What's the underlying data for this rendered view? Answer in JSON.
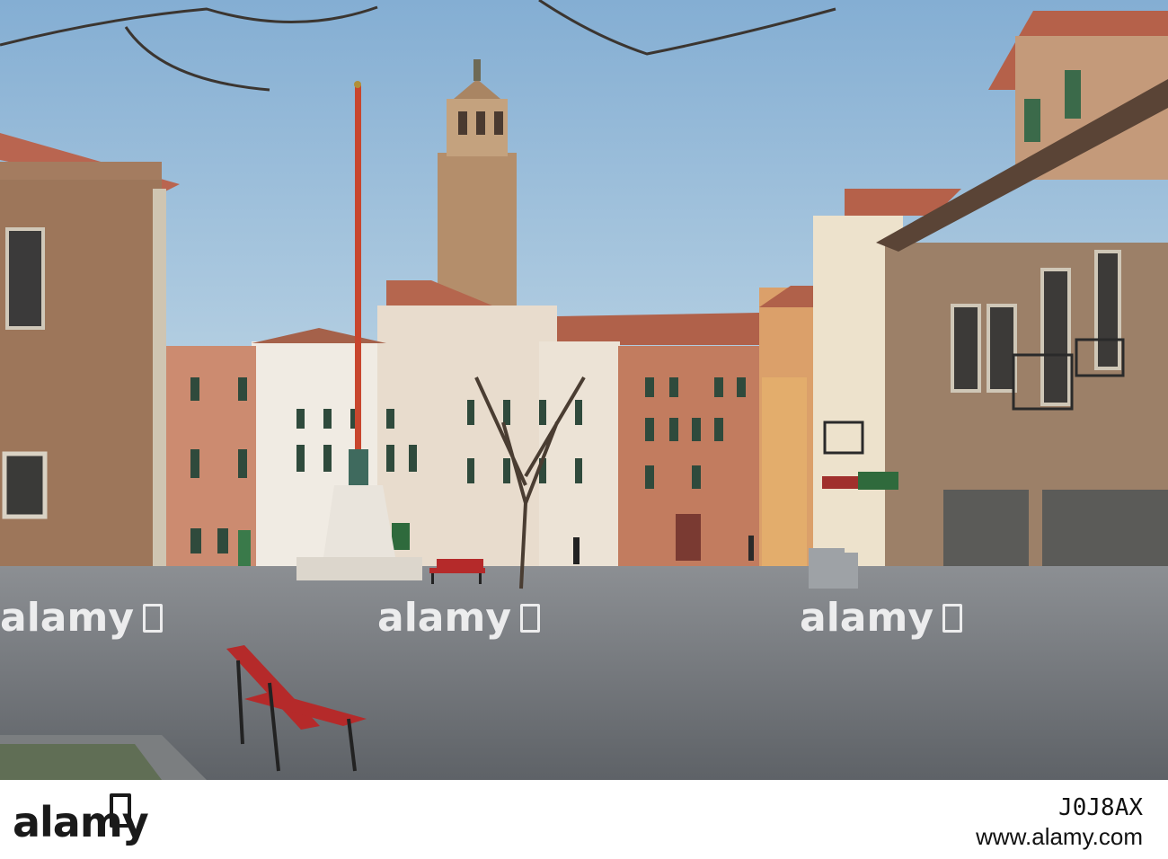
{
  "watermark": {
    "text": "alamy"
  },
  "footer": {
    "brand": "alamy",
    "image_id": "J0J8AX",
    "url": "www.alamy.com"
  },
  "scene": {
    "sky_top": "#8fb6d6",
    "sky_bottom": "#cfe0e8",
    "pavement": "#6f7478",
    "bench_color": "#b52a2a",
    "pole_color": "#c8462e"
  }
}
